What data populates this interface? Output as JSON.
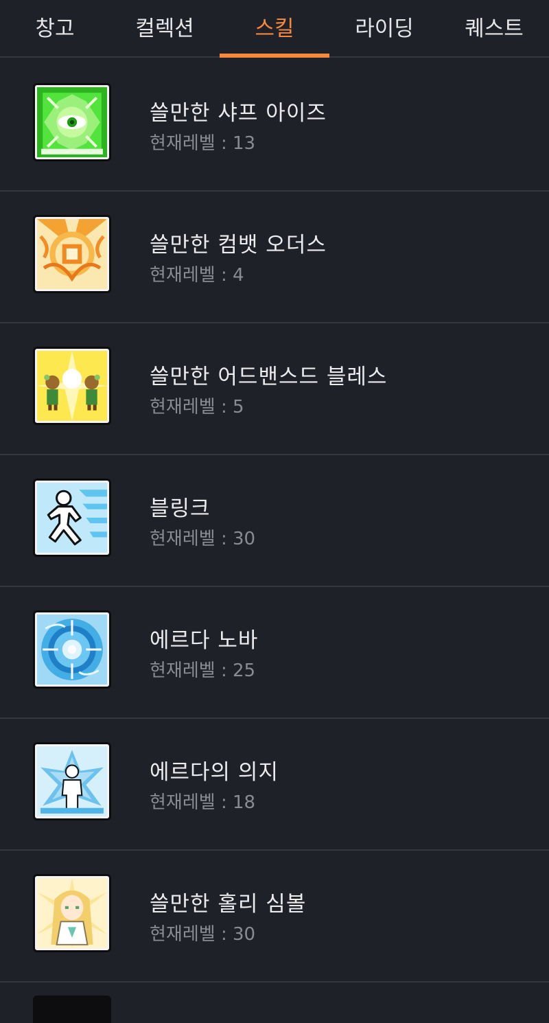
{
  "tabs": [
    {
      "label": "창고",
      "active": false
    },
    {
      "label": "컬렉션",
      "active": false
    },
    {
      "label": "스킬",
      "active": true
    },
    {
      "label": "라이딩",
      "active": false
    },
    {
      "label": "퀘스트",
      "active": false
    }
  ],
  "level_prefix": "현재레벨 : ",
  "skills": [
    {
      "name": "쓸만한 샤프 아이즈",
      "level_text": "현재레벨 : 13",
      "icon": "sharp-eyes-icon",
      "icon_color": "#3ecf2a"
    },
    {
      "name": "쓸만한 컴뱃 오더스",
      "level_text": "현재레벨 : 4",
      "icon": "combat-orders-icon",
      "icon_color": "#f2a033"
    },
    {
      "name": "쓸만한 어드밴스드 블레스",
      "level_text": "현재레벨 : 5",
      "icon": "advanced-blessing-icon",
      "icon_color": "#f6d64a"
    },
    {
      "name": "블링크",
      "level_text": "현재레벨 : 30",
      "icon": "blink-icon",
      "icon_color": "#5fc4ef"
    },
    {
      "name": "에르다 노바",
      "level_text": "현재레벨 : 25",
      "icon": "erda-nova-icon",
      "icon_color": "#2f9ee0"
    },
    {
      "name": "에르다의 의지",
      "level_text": "현재레벨 : 18",
      "icon": "will-of-erda-icon",
      "icon_color": "#4fb5e8"
    },
    {
      "name": "쓸만한 홀리 심볼",
      "level_text": "현재레벨 : 30",
      "icon": "holy-symbol-icon",
      "icon_color": "#f0d58a"
    }
  ],
  "accent_color": "#f5883c"
}
